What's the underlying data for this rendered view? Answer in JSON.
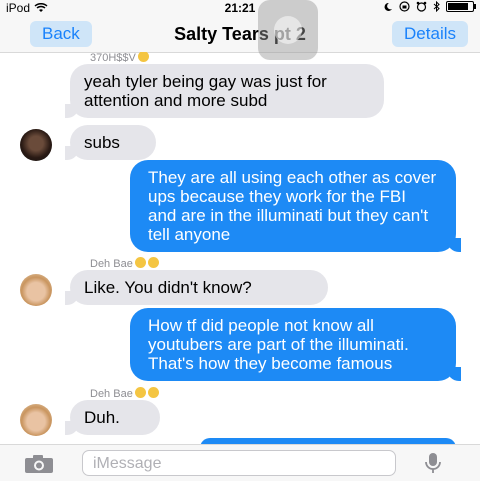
{
  "status_bar": {
    "carrier": "iPod",
    "time": "21:21",
    "battery_level": 0.85,
    "icons": [
      "wifi-icon",
      "moon-icon",
      "lock-rotation-icon",
      "alarm-icon",
      "bluetooth-icon",
      "battery-icon"
    ]
  },
  "nav": {
    "back_label": "Back",
    "title": "Salty Tears pt 2",
    "details_label": "Details"
  },
  "messages": [
    {
      "direction": "in",
      "sender": "370H$$V",
      "text": "yeah tyler being gay was just for attention and more subd",
      "avatar": false
    },
    {
      "direction": "in",
      "text": "subs",
      "avatar": true
    },
    {
      "direction": "out",
      "text": "They are all using each other as cover ups because they work for the FBI and are in the illuminati but they can't tell anyone"
    },
    {
      "direction": "in",
      "sender": "Deh Bae",
      "text": "Like. You didn't know?",
      "avatar": true
    },
    {
      "direction": "out",
      "text": "How tf did people not know all youtubers are part of the illuminati. That's how they become famous"
    },
    {
      "direction": "in",
      "sender": "Deh Bae",
      "text": "Duh.",
      "avatar": true
    }
  ],
  "composer": {
    "placeholder": "iMessage"
  },
  "colors": {
    "outgoing_bubble": "#1d8af5",
    "incoming_bubble": "#e5e5ea",
    "accent": "#1a82fb"
  }
}
